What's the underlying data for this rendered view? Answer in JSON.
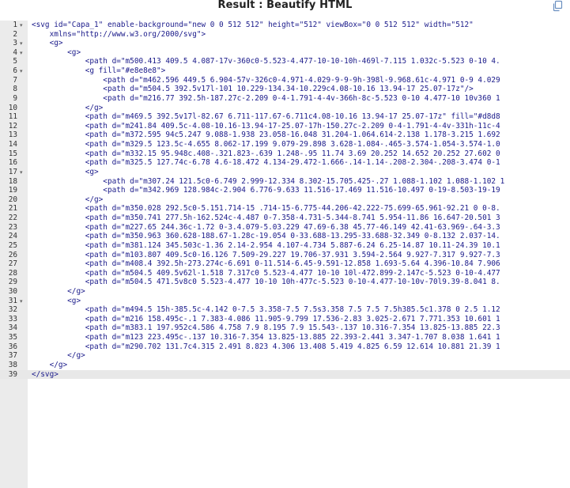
{
  "window": {
    "title": "Result : Beautify HTML",
    "copy_icon": "copy-icon"
  },
  "editor": {
    "lines": [
      {
        "n": "1",
        "fold": true,
        "text": "<svg id=\"Capa_1\" enable-background=\"new 0 0 512 512\" height=\"512\" viewBox=\"0 0 512 512\" width=\"512\""
      },
      {
        "n": "2",
        "fold": false,
        "text": "    xmlns=\"http://www.w3.org/2000/svg\">"
      },
      {
        "n": "3",
        "fold": true,
        "text": "    <g>"
      },
      {
        "n": "4",
        "fold": true,
        "text": "        <g>"
      },
      {
        "n": "5",
        "fold": false,
        "text": "            <path d=\"m500.413 409.5 4.087-17v-360c0-5.523-4.477-10-10-10h-469l-7.115 1.032c-5.523 0-10 4."
      },
      {
        "n": "6",
        "fold": true,
        "text": "            <g fill=\"#e8e8e8\">"
      },
      {
        "n": "7",
        "fold": false,
        "text": "                <path d=\"m462.596 449.5 6.904-57v-326c0-4.971-4.029-9-9-9h-398l-9.968.61c-4.971 0-9 4.029"
      },
      {
        "n": "8",
        "fold": false,
        "text": "                <path d=\"m504.5 392.5v17l-101 10.229-134.34-10.229c4.08-10.16 13.94-17 25.07-17z\"/>"
      },
      {
        "n": "9",
        "fold": false,
        "text": "                <path d=\"m216.77 392.5h-187.27c-2.209 0-4-1.791-4-4v-366h-8c-5.523 0-10 4.477-10 10v360 1"
      },
      {
        "n": "10",
        "fold": false,
        "text": "            </g>"
      },
      {
        "n": "11",
        "fold": false,
        "text": "            <path d=\"m469.5 392.5v17l-82.67 6.711-117.67-6.711c4.08-10.16 13.94-17 25.07-17z\" fill=\"#d8d8"
      },
      {
        "n": "12",
        "fold": false,
        "text": "            <path d=\"m241.84 409.5c-4.08-10.16-13.94-17-25.07-17h-150.27c-2.209 0-4-1.791-4-4v-331h-11c-4"
      },
      {
        "n": "13",
        "fold": false,
        "text": "            <path d=\"m372.595 94c5.247 9.088-1.938 23.058-16.048 31.204-1.064.614-2.138 1.178-3.215 1.692"
      },
      {
        "n": "14",
        "fold": false,
        "text": "            <path d=\"m329.5 123.5c-4.655 8.062-17.199 9.079-29.898 3.628-1.084-.465-3.574-1.054-3.574-1.0"
      },
      {
        "n": "15",
        "fold": false,
        "text": "            <path d=\"m332.15 95.948c.408-.321.823-.639 1.248-.95 11.74 3.69 20.252 14.652 20.252 27.602 0"
      },
      {
        "n": "16",
        "fold": false,
        "text": "            <path d=\"m325.5 127.74c-6.78 4.6-18.472 4.134-29.472-1.666-.14-1.14-.208-2.304-.208-3.474 0-1"
      },
      {
        "n": "17",
        "fold": true,
        "text": "            <g>"
      },
      {
        "n": "18",
        "fold": false,
        "text": "                <path d=\"m307.24 121.5c0-6.749 2.999-12.334 8.302-15.705.425-.27 1.088-1.102 1.088-1.102 1"
      },
      {
        "n": "19",
        "fold": false,
        "text": "                <path d=\"m342.969 128.984c-2.904 6.776-9.633 11.516-17.469 11.516-10.497 0-19-8.503-19-19"
      },
      {
        "n": "20",
        "fold": false,
        "text": "            </g>"
      },
      {
        "n": "21",
        "fold": false,
        "text": "            <path d=\"m350.028 292.5c0-5.151.714-15 .714-15-6.775-44.206-42.222-75.699-65.961-92.21 0 0-8."
      },
      {
        "n": "22",
        "fold": false,
        "text": "            <path d=\"m350.741 277.5h-162.524c-4.487 0-7.358-4.731-5.344-8.741 5.954-11.86 16.647-20.501 3"
      },
      {
        "n": "23",
        "fold": false,
        "text": "            <path d=\"m227.65 244.36c-1.72 0-3.4.079-5.03.229 47.69-6.38 45.77-46.149 42.41-63.969-.64-3.3"
      },
      {
        "n": "24",
        "fold": false,
        "text": "            <path d=\"m350.963 360.628-188.67-1.28c-19.054 0-33.688-13.295-33.688-32.349 0-8.132 2.037-14."
      },
      {
        "n": "25",
        "fold": false,
        "text": "            <path d=\"m381.124 345.503c-1.36 2.14-2.954 4.107-4.734 5.887-6.24 6.25-14.87 10.11-24.39 10.1"
      },
      {
        "n": "26",
        "fold": false,
        "text": "            <path d=\"m103.807 409.5c0-16.126 7.509-29.227 19.706-37.931 3.594-2.564 9.927-7.317 9.927-7.3"
      },
      {
        "n": "27",
        "fold": false,
        "text": "            <path d=\"m408.4 392.5h-273.274c-6.691 0-11.514-6.45-9.591-12.858 1.693-5.64 4.396-10.84 7.906"
      },
      {
        "n": "28",
        "fold": false,
        "text": "            <path d=\"m504.5 409.5v62l-1.518 7.317c0 5.523-4.477 10-10 10l-472.899-2.147c-5.523 0-10-4.477"
      },
      {
        "n": "29",
        "fold": false,
        "text": "            <path d=\"m504.5 471.5v8c0 5.523-4.477 10-10 10h-477c-5.523 0-10-4.477-10-10v-70l9.39-8.041 8."
      },
      {
        "n": "30",
        "fold": false,
        "text": "        </g>"
      },
      {
        "n": "31",
        "fold": true,
        "text": "        <g>"
      },
      {
        "n": "32",
        "fold": false,
        "text": "            <path d=\"m494.5 15h-385.5c-4.142 0-7.5 3.358-7.5 7.5s3.358 7.5 7.5 7.5h385.5c1.378 0 2.5 1.12"
      },
      {
        "n": "33",
        "fold": false,
        "text": "            <path d=\"m216 158.495c-.1 7.383-4.086 11.905-9.799 17.536-2.83 3.025-2.671 7.771.353 10.601 1"
      },
      {
        "n": "34",
        "fold": false,
        "text": "            <path d=\"m383.1 197.952c4.586 4.758 7.9 8.195 7.9 15.543-.137 10.316-7.354 13.825-13.885 22.3"
      },
      {
        "n": "35",
        "fold": false,
        "text": "            <path d=\"m123 223.495c-.137 10.316-7.354 13.825-13.885 22.393-2.441 3.347-1.707 8.038 1.641 1"
      },
      {
        "n": "36",
        "fold": false,
        "text": "            <path d=\"m290.702 131.7c4.315 2.491 8.823 4.306 13.408 5.419 4.825 6.59 12.614 10.881 21.39 1"
      },
      {
        "n": "37",
        "fold": false,
        "text": "        </g>"
      },
      {
        "n": "38",
        "fold": false,
        "text": "    </g>"
      },
      {
        "n": "39",
        "fold": false,
        "text": "</svg>"
      }
    ]
  }
}
